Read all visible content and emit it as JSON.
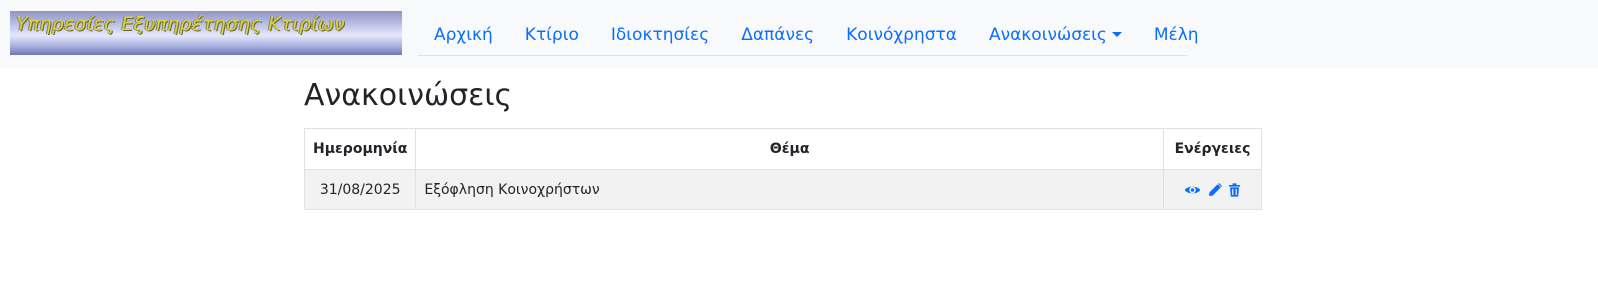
{
  "header": {
    "logo_text": "Υπηρεσίες Εξυπηρέτησης Κτιρίων",
    "nav": [
      {
        "label": "Αρχική"
      },
      {
        "label": "Κτίριο"
      },
      {
        "label": "Ιδιοκτησίες"
      },
      {
        "label": "Δαπάνες"
      },
      {
        "label": "Κοινόχρηστα"
      },
      {
        "label": "Ανακοινώσεις",
        "dropdown": true
      },
      {
        "label": "Μέλη"
      }
    ]
  },
  "main": {
    "title": "Ανακοινώσεις",
    "table": {
      "columns": [
        "Ημερομηνία",
        "Θέμα",
        "Ενέργειες"
      ],
      "rows": [
        {
          "date": "31/08/2025",
          "subject": "Εξόφληση Κοινοχρήστων",
          "actions": [
            "eye-icon",
            "pencil-icon",
            "trash-icon"
          ]
        }
      ]
    }
  },
  "colors": {
    "link": "#0d6efd",
    "navbar_bg": "#f8f9fa",
    "row_bg": "#f2f2f2"
  }
}
